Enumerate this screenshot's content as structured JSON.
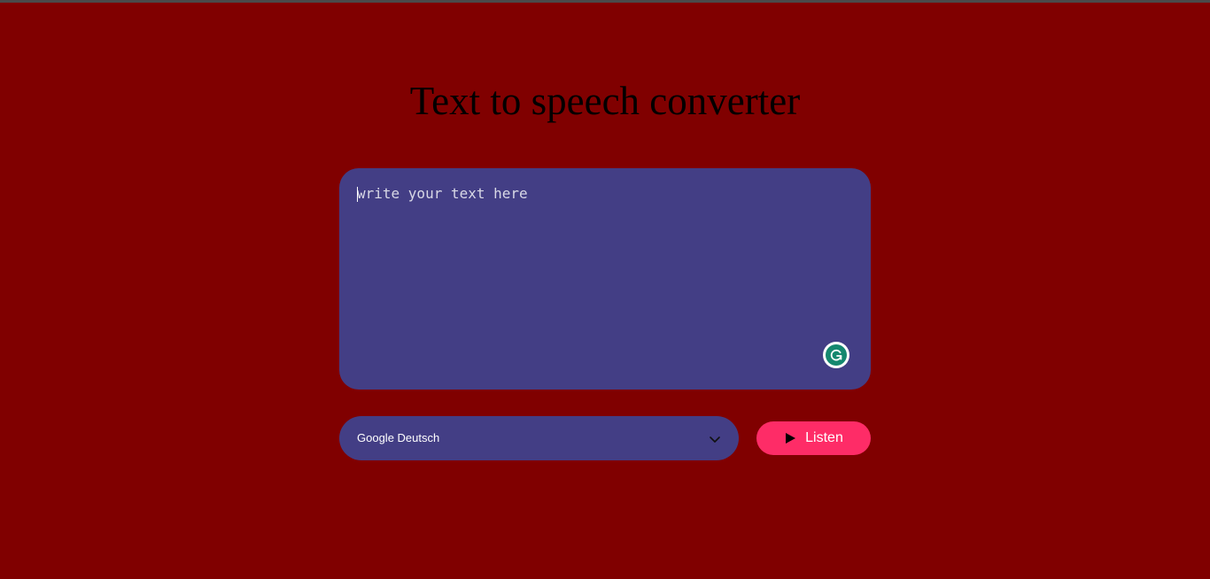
{
  "page": {
    "title": "Text to speech converter"
  },
  "editor": {
    "placeholder": "write your text here",
    "value": "",
    "badge_icon": "grammarly-icon"
  },
  "voice": {
    "selected": "Google Deutsch",
    "dropdown_icon": "chevron-down-icon"
  },
  "listen_button": {
    "label": "Listen",
    "icon": "play-icon"
  },
  "colors": {
    "background": "#800000",
    "panel": "#433e85",
    "accent": "#fe2c67",
    "badge_green": "#15886f"
  }
}
